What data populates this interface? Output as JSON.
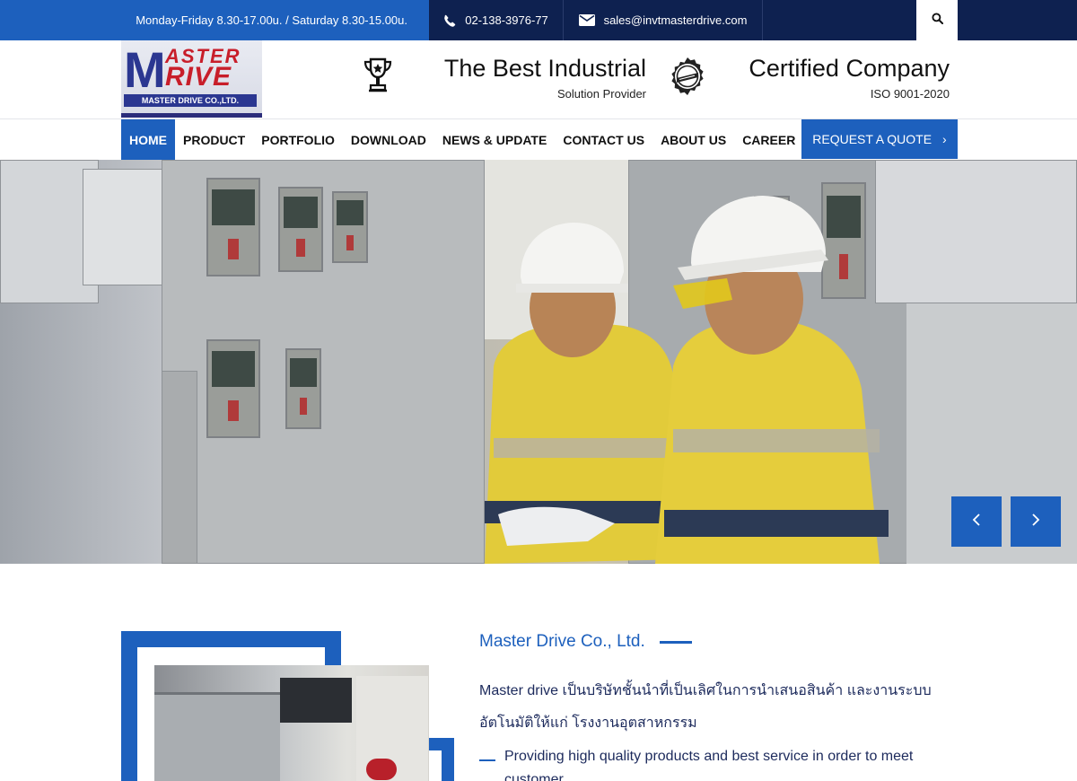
{
  "topbar": {
    "hours": "Monday-Friday 8.30-17.00u. / Saturday 8.30-15.00u.",
    "phone": "02-138-3976-77",
    "email": "sales@invtmasterdrive.com",
    "phone_icon": "phone-icon",
    "email_icon": "envelope-icon",
    "search_icon": "search-icon"
  },
  "header": {
    "logo": {
      "m": "M",
      "aster": "ASTER",
      "rive": "RIVE",
      "subtitle": "MASTER DRIVE CO.,LTD."
    },
    "tagline1": {
      "title": "The Best Industrial",
      "subtitle": "Solution Provider",
      "icon": "trophy-icon"
    },
    "tagline2": {
      "title": "Certified Company",
      "subtitle": "ISO 9001-2020",
      "icon": "approved-seal-icon"
    }
  },
  "nav": {
    "items": [
      "HOME",
      "PRODUCT",
      "PORTFOLIO",
      "DOWNLOAD",
      "NEWS & UPDATE",
      "CONTACT US",
      "ABOUT US",
      "CAREER"
    ],
    "active": "HOME",
    "quote_label": "REQUEST A QUOTE",
    "quote_chevron": "›"
  },
  "hero": {
    "prev_icon": "chevron-left-icon",
    "next_icon": "chevron-right-icon"
  },
  "about": {
    "title": "Master Drive Co., Ltd.",
    "description": "Master drive เป็นบริษัทชั้นนำที่เป็นเลิศในการนำเสนอสินค้า และงานระบบอัตโนมัติให้แก่ โรงงานอุตสาหกรรม",
    "bullet": "Providing high quality products and best service in order to meet customer"
  },
  "colors": {
    "primary_blue": "#1d60bd",
    "navy": "#0e2150",
    "logo_red": "#c81e2a",
    "logo_blue": "#2b3791"
  }
}
